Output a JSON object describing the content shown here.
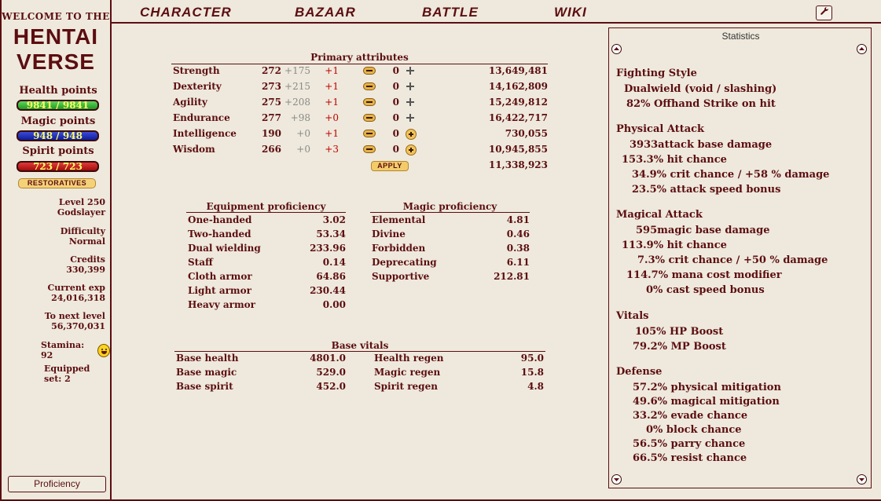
{
  "logo": {
    "welcome": "WELCOME TO THE",
    "line1": "HENTAI",
    "line2": "VERSE"
  },
  "nav": {
    "character": "CHARACTER",
    "bazaar": "BAZAAR",
    "battle": "BATTLE",
    "wiki": "WIKI",
    "settings_icon": "wrench-icon"
  },
  "vitals_bars": {
    "health_label": "Health points",
    "health_value": "9841 / 9841",
    "magic_label": "Magic points",
    "magic_value": "948 / 948",
    "spirit_label": "Spirit points",
    "spirit_value": "723 / 723"
  },
  "restoratives": "RESTORATIVES",
  "character": {
    "level": "Level 250",
    "title": "Godslayer",
    "difficulty_label": "Difficulty",
    "difficulty": "Normal",
    "credits_label": "Credits",
    "credits": "330,399",
    "exp_label": "Current exp",
    "exp": "24,016,318",
    "next_label": "To next level",
    "next": "56,370,031",
    "stamina": "Stamina: 92",
    "equipped": "Equipped set: 2"
  },
  "proficiency_button": "Proficiency",
  "primary": {
    "title": "Primary attributes",
    "rows": [
      {
        "name": "Strength",
        "base": "272",
        "bonus": "+175",
        "mod": "+1",
        "inc": "0",
        "exp": "13,649,481"
      },
      {
        "name": "Dexterity",
        "base": "273",
        "bonus": "+215",
        "mod": "+1",
        "inc": "0",
        "exp": "14,162,809"
      },
      {
        "name": "Agility",
        "base": "275",
        "bonus": "+208",
        "mod": "+1",
        "inc": "0",
        "exp": "15,249,812"
      },
      {
        "name": "Endurance",
        "base": "277",
        "bonus": "+98",
        "mod": "+0",
        "inc": "0",
        "exp": "16,422,717"
      },
      {
        "name": "Intelligence",
        "base": "190",
        "bonus": "+0",
        "mod": "+1",
        "inc": "0",
        "exp": "730,055"
      },
      {
        "name": "Wisdom",
        "base": "266",
        "bonus": "+0",
        "mod": "+3",
        "inc": "0",
        "exp": "10,945,855"
      }
    ],
    "apply": "APPLY",
    "total": "11,338,923"
  },
  "equipment_prof": {
    "title": "Equipment proficiency",
    "rows": [
      {
        "name": "One-handed",
        "value": "3.02"
      },
      {
        "name": "Two-handed",
        "value": "53.34"
      },
      {
        "name": "Dual wielding",
        "value": "233.96"
      },
      {
        "name": "Staff",
        "value": "0.14"
      },
      {
        "name": "Cloth armor",
        "value": "64.86"
      },
      {
        "name": "Light armor",
        "value": "230.44"
      },
      {
        "name": "Heavy armor",
        "value": "0.00"
      }
    ]
  },
  "magic_prof": {
    "title": "Magic proficiency",
    "rows": [
      {
        "name": "Elemental",
        "value": "4.81"
      },
      {
        "name": "Divine",
        "value": "0.46"
      },
      {
        "name": "Forbidden",
        "value": "0.38"
      },
      {
        "name": "Deprecating",
        "value": "6.11"
      },
      {
        "name": "Supportive",
        "value": "212.81"
      }
    ]
  },
  "base_vitals": {
    "title": "Base vitals",
    "left": [
      {
        "name": "Base health",
        "value": "4801.0"
      },
      {
        "name": "Base magic",
        "value": "529.0"
      },
      {
        "name": "Base spirit",
        "value": "452.0"
      }
    ],
    "right": [
      {
        "name": "Health regen",
        "value": "95.0"
      },
      {
        "name": "Magic regen",
        "value": "15.8"
      },
      {
        "name": "Spirit regen",
        "value": "4.8"
      }
    ]
  },
  "statistics": {
    "title": "Statistics",
    "fighting_style": {
      "heading": "Fighting Style",
      "lines": [
        "Dualwield (void / slashing)",
        "82% Offhand Strike on hit"
      ]
    },
    "physical": {
      "heading": "Physical Attack",
      "lines": [
        "3933attack base damage",
        "153.3% hit chance",
        "34.9% crit chance / +58 % damage",
        "23.5% attack speed bonus"
      ]
    },
    "magical": {
      "heading": "Magical Attack",
      "lines": [
        "595magic base damage",
        "113.9% hit chance",
        "7.3% crit chance / +50 % damage",
        "114.7% mana cost modifier",
        "0% cast speed bonus"
      ]
    },
    "vitals": {
      "heading": "Vitals",
      "lines": [
        "105% HP Boost",
        "79.2% MP Boost"
      ]
    },
    "defense": {
      "heading": "Defense",
      "lines": [
        "57.2% physical mitigation",
        "49.6% magical mitigation",
        "33.2% evade chance",
        "0% block chance",
        "56.5% parry chance",
        "66.5% resist chance"
      ]
    }
  },
  "colors": {
    "background": "#eee9dc",
    "text": "#5c0d11",
    "accent_gold": "#f3cc6a",
    "hp": "#1f9a1f",
    "mp": "#101c9a",
    "sp": "#a20d0d"
  }
}
